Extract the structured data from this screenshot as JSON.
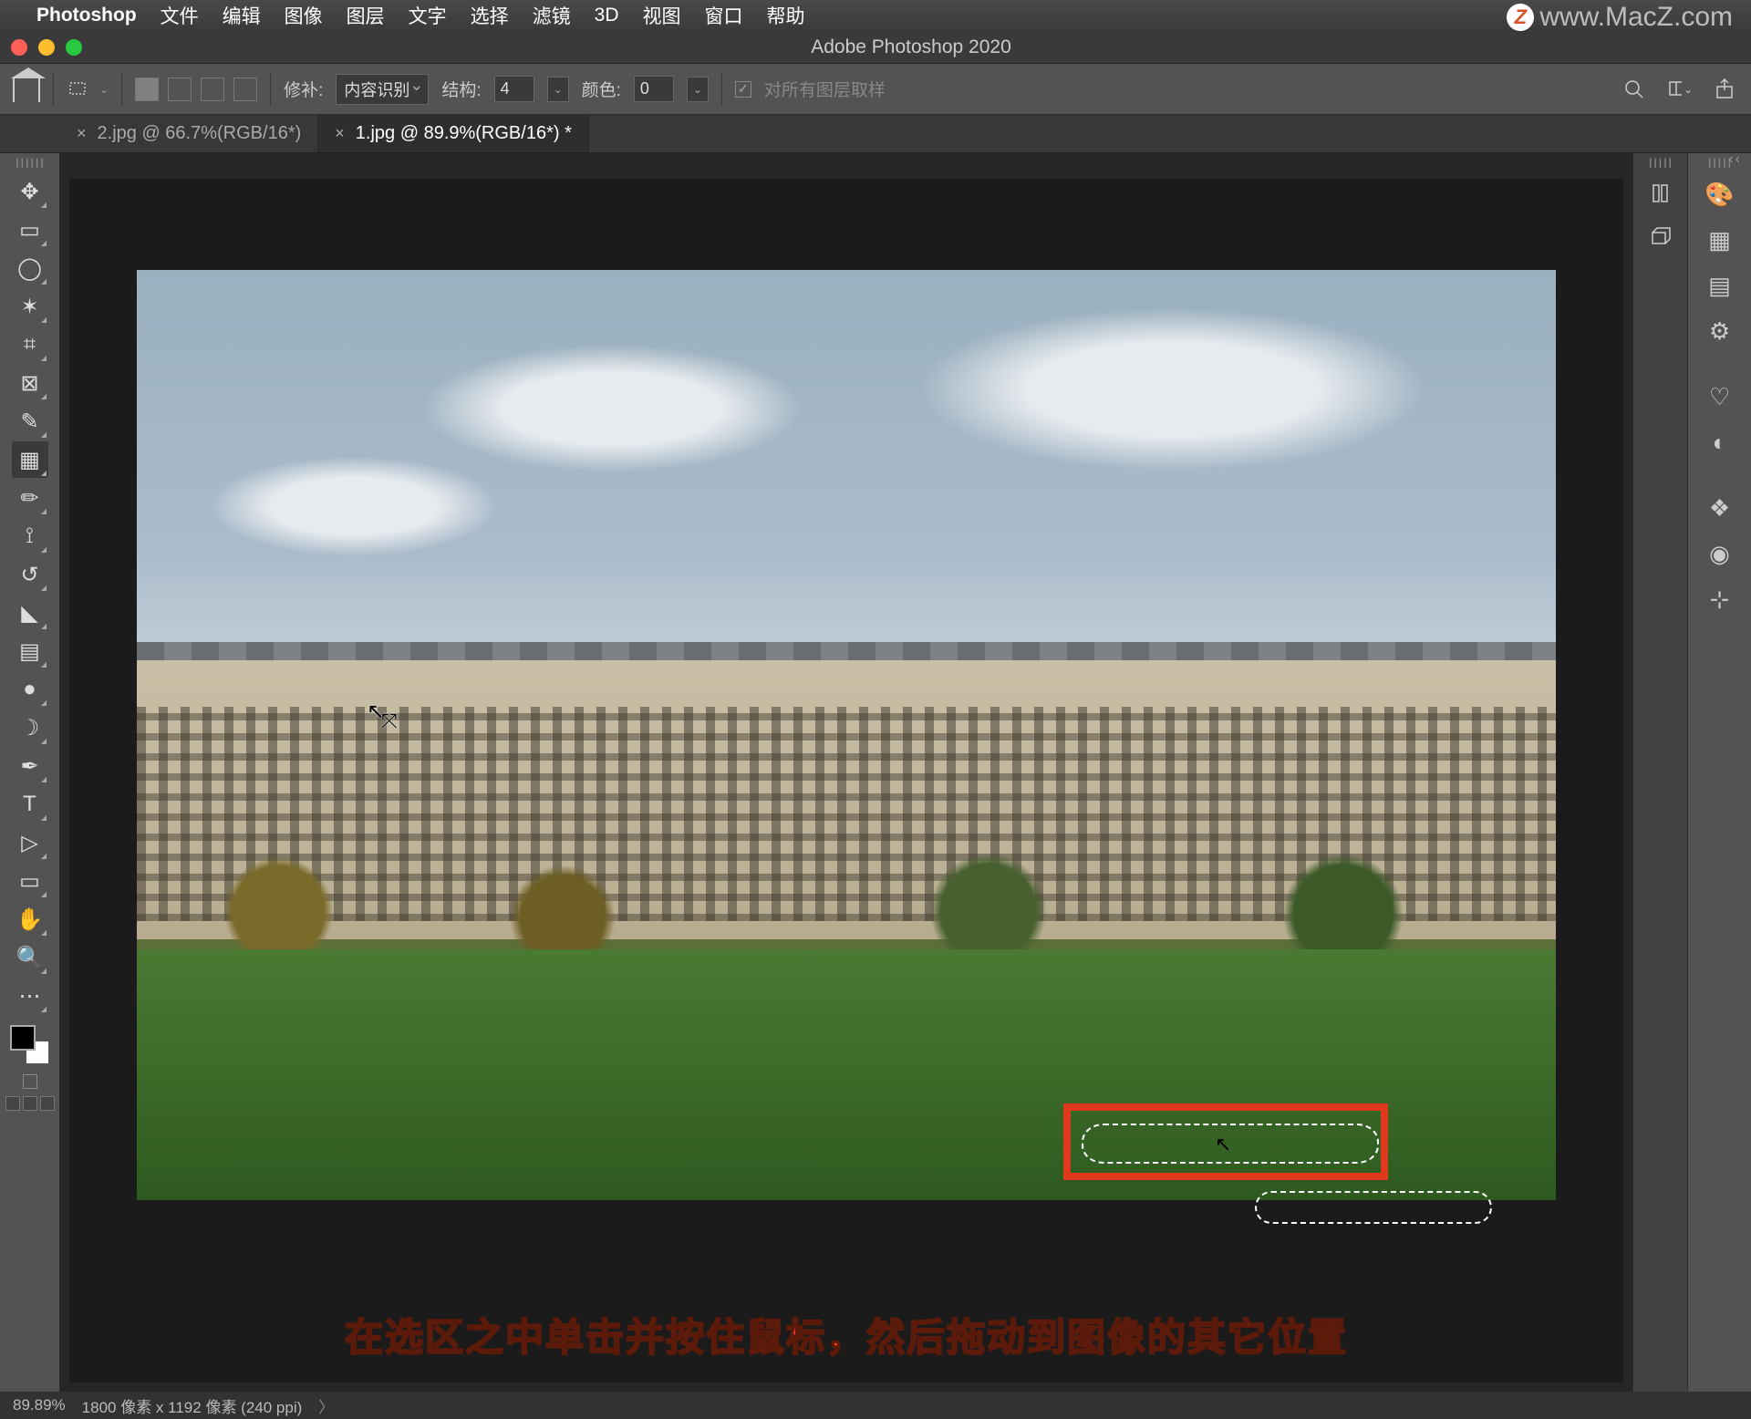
{
  "menubar": {
    "app_name": "Photoshop",
    "items": [
      "文件",
      "编辑",
      "图像",
      "图层",
      "文字",
      "选择",
      "滤镜",
      "3D",
      "视图",
      "窗口",
      "帮助"
    ]
  },
  "watermark": {
    "badge": "Z",
    "text": "www.MacZ.com"
  },
  "window": {
    "title": "Adobe Photoshop 2020"
  },
  "options_bar": {
    "patch_label": "修补:",
    "patch_mode": "内容识别",
    "structure_label": "结构:",
    "structure_value": "4",
    "color_label": "颜色:",
    "color_value": "0",
    "sample_all_label": "对所有图层取样"
  },
  "tabs": [
    {
      "label": "2.jpg @ 66.7%(RGB/16*)",
      "active": false
    },
    {
      "label": "1.jpg @ 89.9%(RGB/16*) *",
      "active": true
    }
  ],
  "tools": [
    {
      "name": "move-tool",
      "glyph": "✥"
    },
    {
      "name": "marquee-tool",
      "glyph": "▭"
    },
    {
      "name": "lasso-tool",
      "glyph": "◯"
    },
    {
      "name": "quick-select-tool",
      "glyph": "✶"
    },
    {
      "name": "crop-tool",
      "glyph": "⌗"
    },
    {
      "name": "frame-tool",
      "glyph": "⊠"
    },
    {
      "name": "eyedropper-tool",
      "glyph": "✎"
    },
    {
      "name": "patch-tool",
      "glyph": "▦",
      "active": true
    },
    {
      "name": "brush-tool",
      "glyph": "✏"
    },
    {
      "name": "stamp-tool",
      "glyph": "⟟"
    },
    {
      "name": "history-brush-tool",
      "glyph": "↺"
    },
    {
      "name": "eraser-tool",
      "glyph": "◣"
    },
    {
      "name": "gradient-tool",
      "glyph": "▤"
    },
    {
      "name": "blur-tool",
      "glyph": "●"
    },
    {
      "name": "dodge-tool",
      "glyph": "☽"
    },
    {
      "name": "pen-tool",
      "glyph": "✒"
    },
    {
      "name": "type-tool",
      "glyph": "T"
    },
    {
      "name": "path-select-tool",
      "glyph": "▷"
    },
    {
      "name": "shape-tool",
      "glyph": "▭"
    },
    {
      "name": "hand-tool",
      "glyph": "✋"
    },
    {
      "name": "zoom-tool",
      "glyph": "🔍"
    },
    {
      "name": "more-tools",
      "glyph": "⋯"
    }
  ],
  "dock_left": [
    {
      "name": "libraries-icon",
      "glyph": "⎚"
    },
    {
      "name": "3d-icon",
      "glyph": "⬚"
    }
  ],
  "panel_strip": [
    {
      "name": "color-icon",
      "glyph": "🎨"
    },
    {
      "name": "swatches-icon",
      "glyph": "▦"
    },
    {
      "name": "gradients-icon",
      "glyph": "▤"
    },
    {
      "name": "adjustments-icon",
      "glyph": "⚙"
    },
    {
      "gap": true
    },
    {
      "name": "learn-icon",
      "glyph": "♡"
    },
    {
      "name": "styles-icon",
      "glyph": "◐"
    },
    {
      "gap": true
    },
    {
      "name": "layers-icon",
      "glyph": "❖"
    },
    {
      "name": "channels-icon",
      "glyph": "◉"
    },
    {
      "name": "paths-icon",
      "glyph": "⊹"
    }
  ],
  "caption": "在选区之中单击并按住鼠标，然后拖动到图像的其它位置",
  "status": {
    "zoom": "89.89%",
    "doc": "1800 像素 x 1192 像素 (240 ppi)"
  },
  "collapse": "‹‹"
}
